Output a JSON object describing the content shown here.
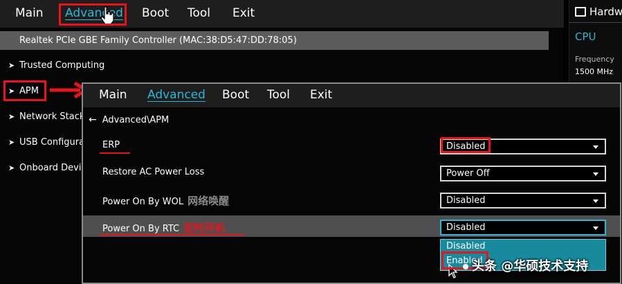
{
  "top_menu": {
    "items": [
      "Main",
      "Advanced",
      "Boot",
      "Tool",
      "Exit"
    ],
    "active": "Advanced"
  },
  "network_controller": "Realtek PCIe GBE Family Controller (MAC:38:D5:47:DD:78:05)",
  "advanced_items": [
    "Trusted Computing",
    "APM",
    "Network Stack",
    "USB Configura",
    "Onboard Devi"
  ],
  "hardware_monitor": {
    "title": "Hardw",
    "cpu_label": "CPU",
    "frequency_label": "Frequency",
    "frequency_value": "1500 MHz"
  },
  "apm_panel": {
    "menu": [
      "Main",
      "Advanced",
      "Boot",
      "Tool",
      "Exit"
    ],
    "breadcrumb": "Advanced\\APM",
    "settings": [
      {
        "label": "ERP",
        "value": "Disabled",
        "note": ""
      },
      {
        "label": "Restore AC Power Loss",
        "value": "Power Off",
        "note": ""
      },
      {
        "label": "Power On By WOL",
        "value": "Disabled",
        "note": "网络唤醒"
      },
      {
        "label": "Power On By RTC",
        "value": "Disabled",
        "note": "定时开机"
      }
    ],
    "dropdown_options": [
      "Disabled",
      "Enabled"
    ]
  },
  "watermark": "头条 @华硕技术支持",
  "colors": {
    "accent": "#2bb8d6",
    "annotation_red": "#e8141a",
    "dropdown_bg": "#178a9e"
  }
}
